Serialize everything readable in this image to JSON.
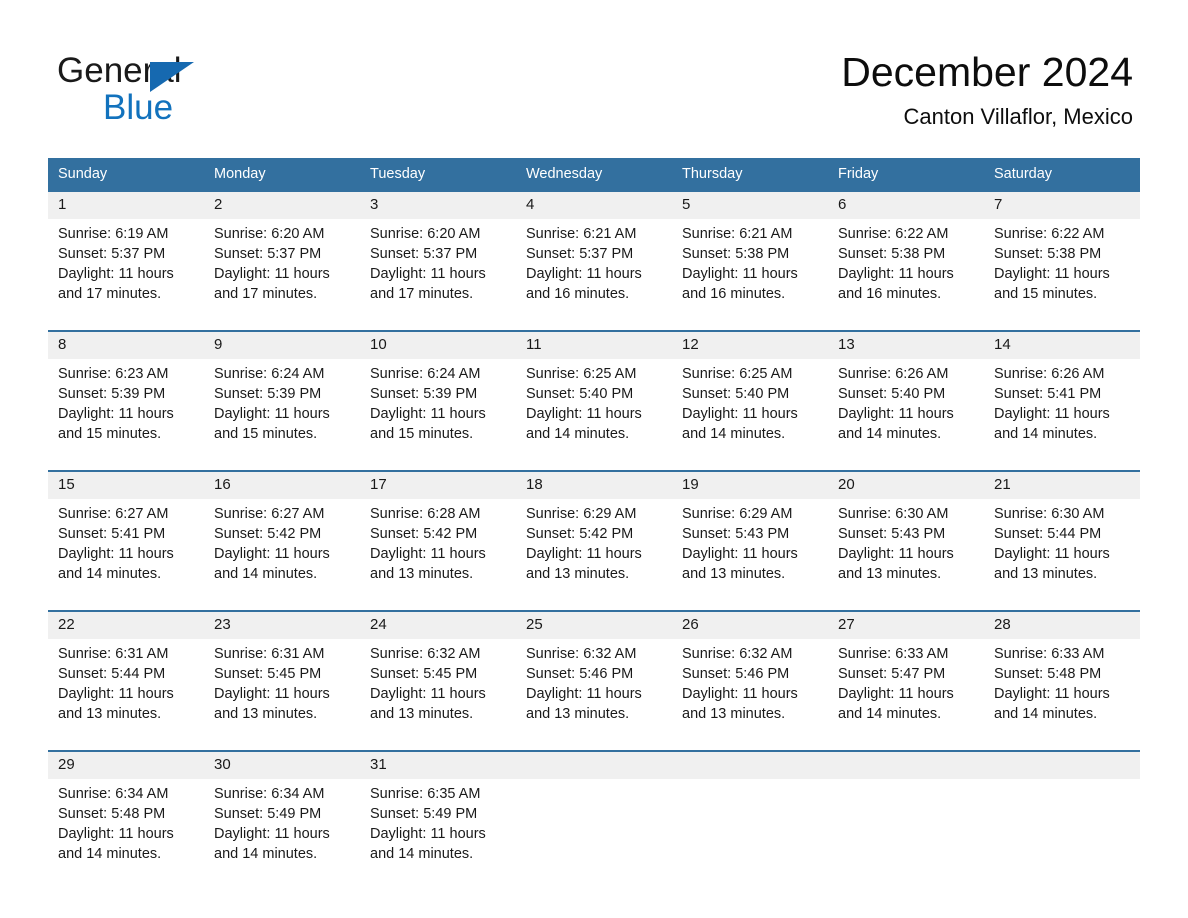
{
  "brand": {
    "name_top": "General",
    "name_bottom": "Blue",
    "triangle_icon": "triangle-icon",
    "color_black": "#1a1a1a",
    "color_blue": "#1272bd"
  },
  "header": {
    "title": "December 2024",
    "location": "Canton Villaflor, Mexico"
  },
  "theme": {
    "accent": "#33709f",
    "daynum_band": "#f0f0f0",
    "text": "#1a1a1a"
  },
  "calendar": {
    "day_headers": [
      "Sunday",
      "Monday",
      "Tuesday",
      "Wednesday",
      "Thursday",
      "Friday",
      "Saturday"
    ],
    "labels": {
      "sunrise": "Sunrise:",
      "sunset": "Sunset:",
      "daylight": "Daylight:"
    },
    "weeks": [
      [
        {
          "day": "1",
          "sunrise": "Sunrise: 6:19 AM",
          "sunset": "Sunset: 5:37 PM",
          "daylight_l1": "Daylight: 11 hours",
          "daylight_l2": "and 17 minutes."
        },
        {
          "day": "2",
          "sunrise": "Sunrise: 6:20 AM",
          "sunset": "Sunset: 5:37 PM",
          "daylight_l1": "Daylight: 11 hours",
          "daylight_l2": "and 17 minutes."
        },
        {
          "day": "3",
          "sunrise": "Sunrise: 6:20 AM",
          "sunset": "Sunset: 5:37 PM",
          "daylight_l1": "Daylight: 11 hours",
          "daylight_l2": "and 17 minutes."
        },
        {
          "day": "4",
          "sunrise": "Sunrise: 6:21 AM",
          "sunset": "Sunset: 5:37 PM",
          "daylight_l1": "Daylight: 11 hours",
          "daylight_l2": "and 16 minutes."
        },
        {
          "day": "5",
          "sunrise": "Sunrise: 6:21 AM",
          "sunset": "Sunset: 5:38 PM",
          "daylight_l1": "Daylight: 11 hours",
          "daylight_l2": "and 16 minutes."
        },
        {
          "day": "6",
          "sunrise": "Sunrise: 6:22 AM",
          "sunset": "Sunset: 5:38 PM",
          "daylight_l1": "Daylight: 11 hours",
          "daylight_l2": "and 16 minutes."
        },
        {
          "day": "7",
          "sunrise": "Sunrise: 6:22 AM",
          "sunset": "Sunset: 5:38 PM",
          "daylight_l1": "Daylight: 11 hours",
          "daylight_l2": "and 15 minutes."
        }
      ],
      [
        {
          "day": "8",
          "sunrise": "Sunrise: 6:23 AM",
          "sunset": "Sunset: 5:39 PM",
          "daylight_l1": "Daylight: 11 hours",
          "daylight_l2": "and 15 minutes."
        },
        {
          "day": "9",
          "sunrise": "Sunrise: 6:24 AM",
          "sunset": "Sunset: 5:39 PM",
          "daylight_l1": "Daylight: 11 hours",
          "daylight_l2": "and 15 minutes."
        },
        {
          "day": "10",
          "sunrise": "Sunrise: 6:24 AM",
          "sunset": "Sunset: 5:39 PM",
          "daylight_l1": "Daylight: 11 hours",
          "daylight_l2": "and 15 minutes."
        },
        {
          "day": "11",
          "sunrise": "Sunrise: 6:25 AM",
          "sunset": "Sunset: 5:40 PM",
          "daylight_l1": "Daylight: 11 hours",
          "daylight_l2": "and 14 minutes."
        },
        {
          "day": "12",
          "sunrise": "Sunrise: 6:25 AM",
          "sunset": "Sunset: 5:40 PM",
          "daylight_l1": "Daylight: 11 hours",
          "daylight_l2": "and 14 minutes."
        },
        {
          "day": "13",
          "sunrise": "Sunrise: 6:26 AM",
          "sunset": "Sunset: 5:40 PM",
          "daylight_l1": "Daylight: 11 hours",
          "daylight_l2": "and 14 minutes."
        },
        {
          "day": "14",
          "sunrise": "Sunrise: 6:26 AM",
          "sunset": "Sunset: 5:41 PM",
          "daylight_l1": "Daylight: 11 hours",
          "daylight_l2": "and 14 minutes."
        }
      ],
      [
        {
          "day": "15",
          "sunrise": "Sunrise: 6:27 AM",
          "sunset": "Sunset: 5:41 PM",
          "daylight_l1": "Daylight: 11 hours",
          "daylight_l2": "and 14 minutes."
        },
        {
          "day": "16",
          "sunrise": "Sunrise: 6:27 AM",
          "sunset": "Sunset: 5:42 PM",
          "daylight_l1": "Daylight: 11 hours",
          "daylight_l2": "and 14 minutes."
        },
        {
          "day": "17",
          "sunrise": "Sunrise: 6:28 AM",
          "sunset": "Sunset: 5:42 PM",
          "daylight_l1": "Daylight: 11 hours",
          "daylight_l2": "and 13 minutes."
        },
        {
          "day": "18",
          "sunrise": "Sunrise: 6:29 AM",
          "sunset": "Sunset: 5:42 PM",
          "daylight_l1": "Daylight: 11 hours",
          "daylight_l2": "and 13 minutes."
        },
        {
          "day": "19",
          "sunrise": "Sunrise: 6:29 AM",
          "sunset": "Sunset: 5:43 PM",
          "daylight_l1": "Daylight: 11 hours",
          "daylight_l2": "and 13 minutes."
        },
        {
          "day": "20",
          "sunrise": "Sunrise: 6:30 AM",
          "sunset": "Sunset: 5:43 PM",
          "daylight_l1": "Daylight: 11 hours",
          "daylight_l2": "and 13 minutes."
        },
        {
          "day": "21",
          "sunrise": "Sunrise: 6:30 AM",
          "sunset": "Sunset: 5:44 PM",
          "daylight_l1": "Daylight: 11 hours",
          "daylight_l2": "and 13 minutes."
        }
      ],
      [
        {
          "day": "22",
          "sunrise": "Sunrise: 6:31 AM",
          "sunset": "Sunset: 5:44 PM",
          "daylight_l1": "Daylight: 11 hours",
          "daylight_l2": "and 13 minutes."
        },
        {
          "day": "23",
          "sunrise": "Sunrise: 6:31 AM",
          "sunset": "Sunset: 5:45 PM",
          "daylight_l1": "Daylight: 11 hours",
          "daylight_l2": "and 13 minutes."
        },
        {
          "day": "24",
          "sunrise": "Sunrise: 6:32 AM",
          "sunset": "Sunset: 5:45 PM",
          "daylight_l1": "Daylight: 11 hours",
          "daylight_l2": "and 13 minutes."
        },
        {
          "day": "25",
          "sunrise": "Sunrise: 6:32 AM",
          "sunset": "Sunset: 5:46 PM",
          "daylight_l1": "Daylight: 11 hours",
          "daylight_l2": "and 13 minutes."
        },
        {
          "day": "26",
          "sunrise": "Sunrise: 6:32 AM",
          "sunset": "Sunset: 5:46 PM",
          "daylight_l1": "Daylight: 11 hours",
          "daylight_l2": "and 13 minutes."
        },
        {
          "day": "27",
          "sunrise": "Sunrise: 6:33 AM",
          "sunset": "Sunset: 5:47 PM",
          "daylight_l1": "Daylight: 11 hours",
          "daylight_l2": "and 14 minutes."
        },
        {
          "day": "28",
          "sunrise": "Sunrise: 6:33 AM",
          "sunset": "Sunset: 5:48 PM",
          "daylight_l1": "Daylight: 11 hours",
          "daylight_l2": "and 14 minutes."
        }
      ],
      [
        {
          "day": "29",
          "sunrise": "Sunrise: 6:34 AM",
          "sunset": "Sunset: 5:48 PM",
          "daylight_l1": "Daylight: 11 hours",
          "daylight_l2": "and 14 minutes."
        },
        {
          "day": "30",
          "sunrise": "Sunrise: 6:34 AM",
          "sunset": "Sunset: 5:49 PM",
          "daylight_l1": "Daylight: 11 hours",
          "daylight_l2": "and 14 minutes."
        },
        {
          "day": "31",
          "sunrise": "Sunrise: 6:35 AM",
          "sunset": "Sunset: 5:49 PM",
          "daylight_l1": "Daylight: 11 hours",
          "daylight_l2": "and 14 minutes."
        },
        {
          "day": "",
          "sunrise": "",
          "sunset": "",
          "daylight_l1": "",
          "daylight_l2": ""
        },
        {
          "day": "",
          "sunrise": "",
          "sunset": "",
          "daylight_l1": "",
          "daylight_l2": ""
        },
        {
          "day": "",
          "sunrise": "",
          "sunset": "",
          "daylight_l1": "",
          "daylight_l2": ""
        },
        {
          "day": "",
          "sunrise": "",
          "sunset": "",
          "daylight_l1": "",
          "daylight_l2": ""
        }
      ]
    ]
  }
}
